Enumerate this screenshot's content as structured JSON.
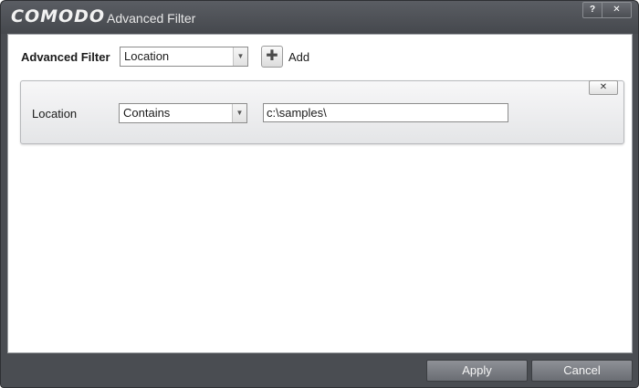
{
  "window": {
    "brand": "COMODO",
    "title": "Advanced Filter",
    "help_label": "?",
    "close_label": "✕"
  },
  "filter": {
    "label": "Advanced Filter",
    "selected": "Location",
    "add_label": "Add",
    "add_icon": "plus-icon"
  },
  "rule": {
    "close_label": "✕",
    "field_label": "Location",
    "condition_selected": "Contains",
    "value": "c:\\samples\\"
  },
  "footer": {
    "apply_label": "Apply",
    "cancel_label": "Cancel"
  },
  "colors": {
    "chrome": "#4a4d52",
    "panel": "#e9eaec",
    "button": "#7c7f85"
  }
}
